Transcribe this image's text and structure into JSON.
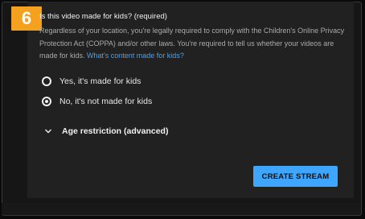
{
  "step_badge": "6",
  "kids_section": {
    "question": "Is this video made for kids? (required)",
    "description": "Regardless of your location, you're legally required to comply with the Children's Online Privacy Protection Act (COPPA) and/or other laws. You're required to tell us whether your videos are made for kids.",
    "link_text": "What's content made for kids?",
    "options": [
      {
        "label": "Yes, it's made for kids",
        "selected": false
      },
      {
        "label": "No, it's not made for kids",
        "selected": true
      }
    ]
  },
  "age_restriction": {
    "label": "Age restriction (advanced)",
    "icon": "chevron-down-icon"
  },
  "create_button": {
    "label": "CREATE STREAM"
  },
  "colors": {
    "badge": "#f3a11f",
    "accent": "#3ea6ff",
    "panel": "#212121"
  }
}
